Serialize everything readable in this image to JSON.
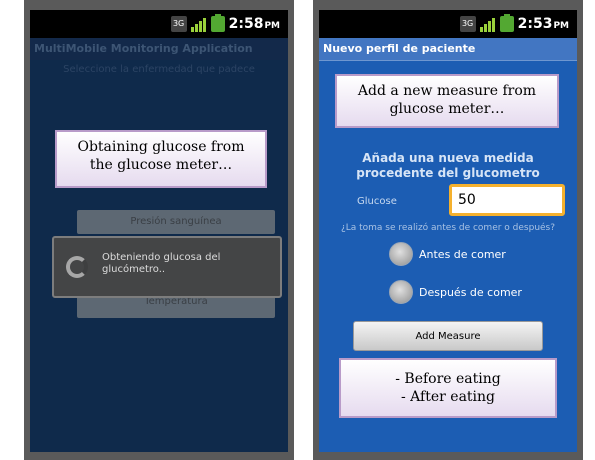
{
  "left": {
    "status": {
      "time": "2:58",
      "ampm": "PM",
      "network": "3G"
    },
    "app_title": "MultiMobile Monitoring Application",
    "prompt": "Seleccione la enfermedad que padece",
    "annotation": [
      "Obtaining glucose from",
      "the glucose meter…"
    ],
    "buttons": [
      "Presión sanguínea",
      "Temperatura"
    ],
    "dialog_message": [
      "Obteniendo glucosa del",
      "glucómetro.."
    ]
  },
  "right": {
    "status": {
      "time": "2:53",
      "ampm": "PM",
      "network": "3G"
    },
    "screen_title": "Nuevo perfil de paciente",
    "annotation_top": [
      "Add a new measure from",
      "glucose meter…"
    ],
    "heading": [
      "Añada una nueva medida",
      "procedente del glucometro"
    ],
    "glucose_label": "Glucose",
    "glucose_value": "50",
    "question": "¿La toma se realizó antes de comer o después?",
    "radio_before": "Antes de comer",
    "radio_after": "Después de comer",
    "add_button": "Add Measure",
    "annotation_bottom": [
      "- Before eating",
      "- After eating"
    ]
  }
}
